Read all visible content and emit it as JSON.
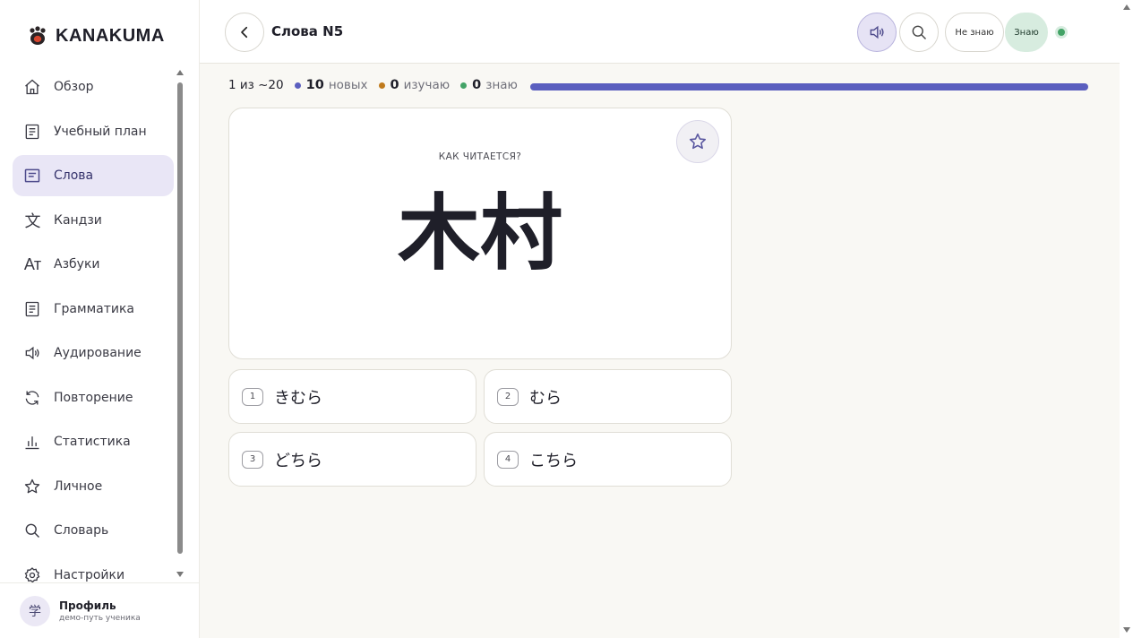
{
  "app": {
    "name": "KANAKUMA"
  },
  "sidebar": {
    "items": [
      {
        "label": "Обзор",
        "icon": "home-icon",
        "active": false
      },
      {
        "label": "Учебный план",
        "icon": "document-icon",
        "active": false
      },
      {
        "label": "Слова",
        "icon": "cards-icon",
        "active": true
      },
      {
        "label": "Кандзи",
        "icon": "kanji-icon",
        "active": false
      },
      {
        "label": "Азбуки",
        "icon": "alphabet-icon",
        "active": false
      },
      {
        "label": "Грамматика",
        "icon": "document-icon",
        "active": false
      },
      {
        "label": "Аудирование",
        "icon": "speaker-icon",
        "active": false
      },
      {
        "label": "Повторение",
        "icon": "refresh-icon",
        "active": false
      },
      {
        "label": "Статистика",
        "icon": "bar-chart-icon",
        "active": false
      },
      {
        "label": "Личное",
        "icon": "star-icon",
        "active": false
      },
      {
        "label": "Словарь",
        "icon": "search-icon",
        "active": false
      },
      {
        "label": "Настройки",
        "icon": "gear-icon",
        "active": false
      }
    ],
    "kanji_icon_glyph": "文",
    "alphabet_icon_glyph": "Aт"
  },
  "profile": {
    "name": "Профиль",
    "subtitle": "демо-путь ученика",
    "avatar_glyph": "学"
  },
  "header": {
    "title": "Слова N5",
    "dont_know_label": "Не знаю",
    "know_label": "Знаю"
  },
  "progress": {
    "position": "1 из ~20",
    "new_count": "10",
    "new_label": "новых",
    "learning_count": "0",
    "learning_label": "изучаю",
    "known_count": "0",
    "known_label": "знаю",
    "fill": 1.0
  },
  "card": {
    "prompt": "КАК ЧИТАЕТСЯ?",
    "word": "木村"
  },
  "options": [
    {
      "num": "1",
      "text": "きむら"
    },
    {
      "num": "2",
      "text": "むら"
    },
    {
      "num": "3",
      "text": "どちら"
    },
    {
      "num": "4",
      "text": "こちら"
    }
  ],
  "colors": {
    "accent": "#5b5fbf",
    "active_nav_bg": "#e9e6f6",
    "new_dot": "#5b5fbf",
    "learning_dot": "#c07a1c",
    "known_dot": "#43a366",
    "know_btn_bg": "#d7ecdf"
  }
}
